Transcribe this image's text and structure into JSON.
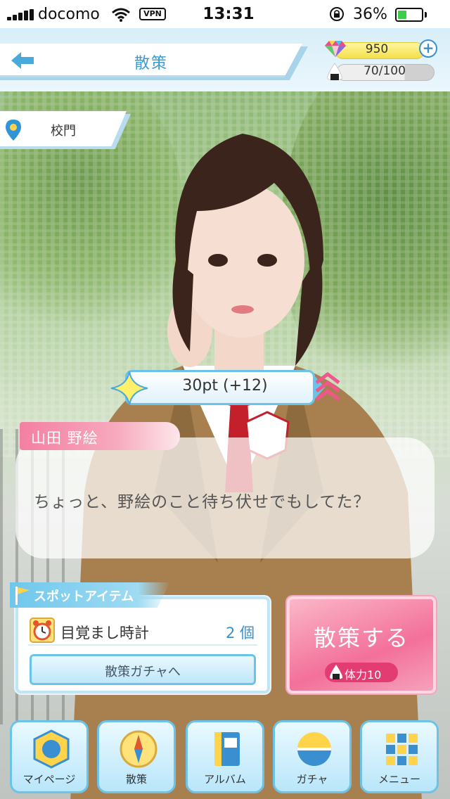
{
  "status_bar": {
    "carrier": "docomo",
    "vpn": "VPN",
    "time": "13:31",
    "battery_pct": "36%",
    "battery_level": 0.36,
    "battery_color": "#3fcc4a"
  },
  "header": {
    "title": "散策",
    "back_icon": "arrow-left-icon",
    "gems": "950",
    "stamina": "70/100",
    "stamina_fraction": 0.7
  },
  "location": {
    "name": "校門",
    "icon": "map-pin-icon"
  },
  "points": {
    "text": "30pt (+12)"
  },
  "dialogue": {
    "speaker": "山田 野絵",
    "text": "ちょっと、野絵のこと待ち伏せでもしてた？"
  },
  "spot_item": {
    "title": "スポットアイテム",
    "item_name": "目覚まし時計",
    "item_count": "2 個",
    "gacha_link": "散策ガチャへ"
  },
  "walk_button": {
    "label": "散策する",
    "cost": "体力10"
  },
  "nav": [
    {
      "label": "マイページ",
      "icon": "badge-icon"
    },
    {
      "label": "散策",
      "icon": "compass-icon"
    },
    {
      "label": "アルバム",
      "icon": "album-icon"
    },
    {
      "label": "ガチャ",
      "icon": "gacha-capsule-icon"
    },
    {
      "label": "メニュー",
      "icon": "menu-grid-icon"
    }
  ],
  "colors": {
    "accent_blue": "#3a9ccd",
    "pink": "#f3709a",
    "name_tag": "#f47fa2"
  }
}
